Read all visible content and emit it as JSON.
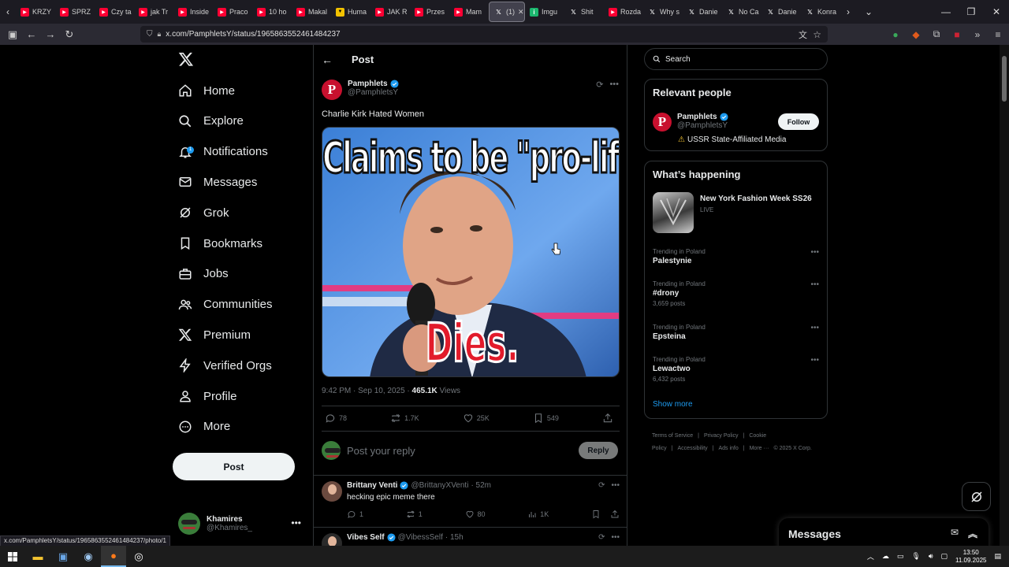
{
  "browser": {
    "tabs": [
      {
        "label": "KRZY",
        "icon": "youtube-icon",
        "color": "#ff0033"
      },
      {
        "label": "SPRZ",
        "icon": "youtube-icon",
        "color": "#ff0033"
      },
      {
        "label": "Czy ta",
        "icon": "youtube-icon",
        "color": "#ff0033"
      },
      {
        "label": "jak Tr",
        "icon": "youtube-icon",
        "color": "#ff0033"
      },
      {
        "label": "Inside",
        "icon": "youtube-icon",
        "color": "#ff0033"
      },
      {
        "label": "Praco",
        "icon": "youtube-icon",
        "color": "#ff0033"
      },
      {
        "label": "10 ho",
        "icon": "youtube-icon",
        "color": "#ff0033"
      },
      {
        "label": "Makal",
        "icon": "youtube-icon",
        "color": "#ff0033"
      },
      {
        "label": "Huma",
        "icon": "bookmark-icon",
        "color": "#f2c200"
      },
      {
        "label": "JAK R",
        "icon": "youtube-icon",
        "color": "#ff0033"
      },
      {
        "label": "Przes",
        "icon": "youtube-icon",
        "color": "#ff0033"
      },
      {
        "label": "Mam",
        "icon": "youtube-icon",
        "color": "#ff0033"
      },
      {
        "label": "(1)",
        "icon": "x-icon",
        "color": "#ffffff",
        "active": true
      },
      {
        "label": "Imgu",
        "icon": "imgur-icon",
        "color": "#1bb76e"
      },
      {
        "label": "Shit",
        "icon": "x-icon",
        "color": "#ffffff"
      },
      {
        "label": "Rozda",
        "icon": "youtube-icon",
        "color": "#ff0033"
      },
      {
        "label": "Why s",
        "icon": "x-icon",
        "color": "#ffffff"
      },
      {
        "label": "Danie",
        "icon": "x-icon",
        "color": "#ffffff"
      },
      {
        "label": "No Ca",
        "icon": "x-icon",
        "color": "#ffffff"
      },
      {
        "label": "Danie",
        "icon": "x-icon",
        "color": "#ffffff"
      },
      {
        "label": "Konra",
        "icon": "x-icon",
        "color": "#ffffff"
      }
    ],
    "url": "x.com/PamphletsY/status/1965863552461484237",
    "status_link": "x.com/PamphletsY/status/1965863552461484237/photo/1"
  },
  "sidebar": {
    "items": [
      {
        "label": "Home",
        "icon": "home-icon"
      },
      {
        "label": "Explore",
        "icon": "search-icon"
      },
      {
        "label": "Notifications",
        "icon": "bell-icon",
        "badge": "1"
      },
      {
        "label": "Messages",
        "icon": "envelope-icon"
      },
      {
        "label": "Grok",
        "icon": "grok-icon"
      },
      {
        "label": "Bookmarks",
        "icon": "bookmark-icon"
      },
      {
        "label": "Jobs",
        "icon": "briefcase-icon"
      },
      {
        "label": "Communities",
        "icon": "people-icon"
      },
      {
        "label": "Premium",
        "icon": "x-logo-icon"
      },
      {
        "label": "Verified Orgs",
        "icon": "lightning-icon"
      },
      {
        "label": "Profile",
        "icon": "person-icon"
      },
      {
        "label": "More",
        "icon": "more-circle-icon"
      }
    ],
    "post_label": "Post",
    "account": {
      "name": "Khamires",
      "handle": "@Khamires_"
    }
  },
  "post": {
    "header_title": "Post",
    "author_name": "Pamphlets",
    "author_handle": "@PamphletsY",
    "text": "Charlie Kirk Hated Women",
    "image_caption_top": "Claims to be \"pro-life\"",
    "image_caption_bottom": "Dies.",
    "time": "9:42 PM · Sep 10, 2025",
    "views_count": "465.1K",
    "views_label": "Views",
    "replies": "78",
    "reposts": "1.7K",
    "likes": "25K",
    "bookmarks": "549"
  },
  "reply_box": {
    "placeholder": "Post your reply",
    "button": "Reply"
  },
  "comments": [
    {
      "name": "Brittany Venti",
      "handle": "@BrittanyXVenti",
      "time": "· 52m",
      "text": "hecking epic meme there",
      "replies": "1",
      "reposts": "1",
      "likes": "80",
      "views": "1K"
    },
    {
      "name": "Vibes Self",
      "handle": "@VibessSelf",
      "time": "· 15h",
      "text": ""
    }
  ],
  "right": {
    "search_placeholder": "Search",
    "relevant_title": "Relevant people",
    "relevant_name": "Pamphlets",
    "relevant_handle": "@PamphletsY",
    "relevant_label": "USSR State-Affiliated Media",
    "follow_label": "Follow",
    "happening_title": "What’s happening",
    "featured": {
      "title": "New York Fashion Week SS26",
      "status": "LIVE"
    },
    "trends": [
      {
        "context": "Trending in Poland",
        "title": "Palestynie",
        "count": ""
      },
      {
        "context": "Trending in Poland",
        "title": "#drony",
        "count": "3,659 posts"
      },
      {
        "context": "Trending in Poland",
        "title": "Epsteina",
        "count": ""
      },
      {
        "context": "Trending in Poland",
        "title": "Lewactwo",
        "count": "6,432 posts"
      }
    ],
    "show_more": "Show more",
    "footer": [
      "Terms of Service",
      "|",
      "Privacy Policy",
      "|",
      "Cookie Policy",
      "|",
      "Accessibility",
      "|",
      "Ads info",
      "|",
      "More ···",
      "© 2025 X Corp."
    ]
  },
  "messages_drawer": {
    "title": "Messages"
  },
  "taskbar": {
    "time": "13:50",
    "date": "11.09.2025"
  },
  "colors": {
    "accent": "#1d9bf0",
    "bg": "#000000",
    "border": "#2f3336",
    "muted": "#71767b"
  }
}
